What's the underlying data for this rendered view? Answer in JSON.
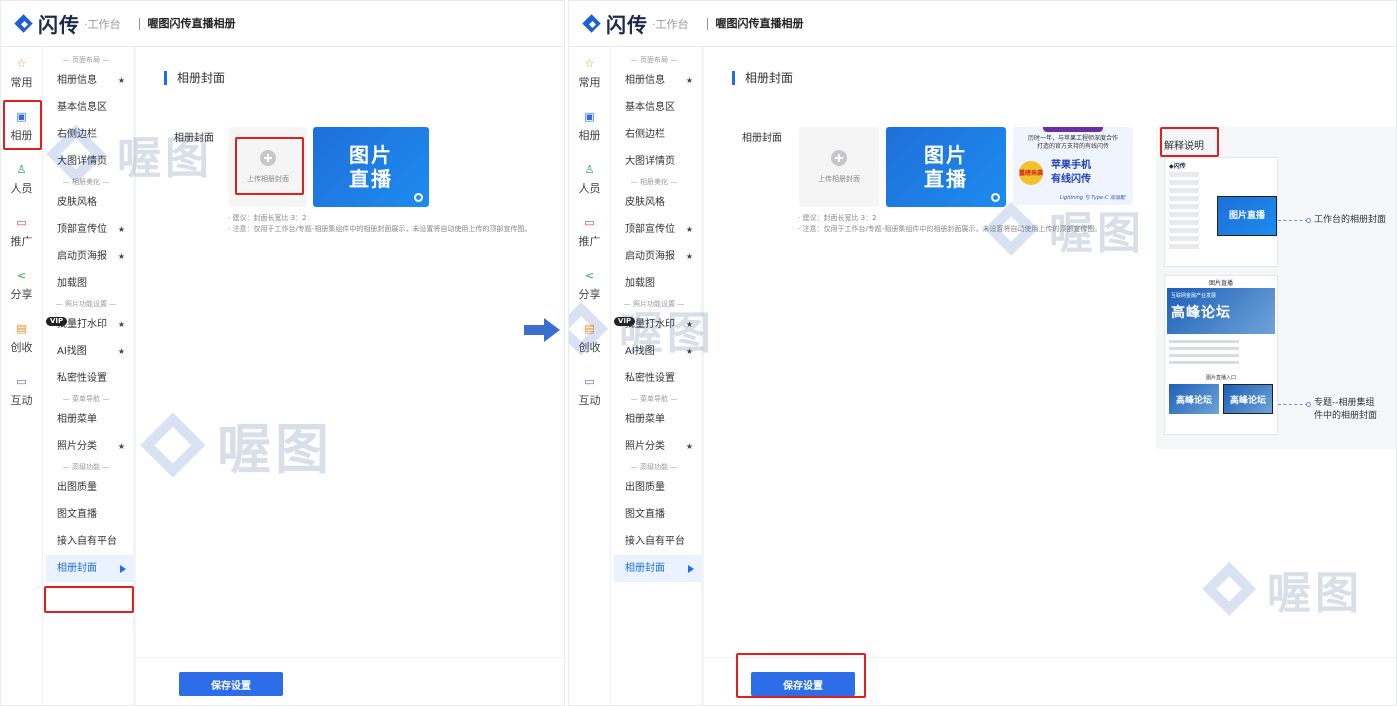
{
  "app": {
    "logo_text": "闪传",
    "logo_sub": "·工作台",
    "title": "喔图闪传直播相册"
  },
  "rail": [
    {
      "label": "常用",
      "icon": "star-icon"
    },
    {
      "label": "相册",
      "icon": "album-icon"
    },
    {
      "label": "人员",
      "icon": "people-icon"
    },
    {
      "label": "推广",
      "icon": "promote-icon"
    },
    {
      "label": "分享",
      "icon": "share-icon"
    },
    {
      "label": "创收",
      "icon": "revenue-icon"
    },
    {
      "label": "互动",
      "icon": "interact-icon"
    }
  ],
  "nav": {
    "group_layout": "— 页面布局 —",
    "group_beautify": "— 相册美化 —",
    "group_photo": "— 照片功能设置 —",
    "group_menu": "— 菜单导航 —",
    "group_advanced": "— 高级功能 —",
    "items": {
      "album_info": "相册信息",
      "basic_info": "基本信息区",
      "right_sidebar": "右侧边栏",
      "big_image": "大图详情页",
      "skin": "皮肤风格",
      "top_banner": "顶部宣传位",
      "splash": "启动页海报",
      "loading": "加载图",
      "watermark": "批量打水印",
      "ai_find": "AI找图",
      "privacy": "私密性设置",
      "album_menu": "相册菜单",
      "photo_category": "照片分类",
      "output_quality": "出图质量",
      "text_live": "图文直播",
      "platform": "接入自有平台",
      "album_cover": "相册封面"
    },
    "star": "★",
    "vip": "VIP"
  },
  "content": {
    "section_title": "相册封面",
    "field_label": "相册封面",
    "upload_label": "上传相册封面",
    "cover_text_line1": "图片",
    "cover_text_line2": "直播",
    "hint1": "· 建议：封面长宽比 3：2",
    "hint2": "· 注意：仅用于工作台/专题-相册集组件中的相册封面展示，未设置将自动使用上传的顶部宣传图。",
    "save_label": "保存设置"
  },
  "promo": {
    "head_line1": "历时一年，与苹果工程师深度合作",
    "head_line2": "打造的官方支持的有线闪传",
    "badge": "重磅来袭",
    "title_line1": "苹果手机",
    "title_line2": "有线闪传",
    "foot": "Lightning 与 Type-C 双适配"
  },
  "explain": {
    "title": "解释说明",
    "mini_logo": "◆闪传",
    "mini_cover": "图片直播",
    "mini2_head": "图片直播",
    "mini2_sub": "互联网金融产业发展",
    "mini2_big": "高峰论坛",
    "mini2_entry": "图片直播入口",
    "mini_card": "高峰论坛",
    "callout1": "工作台的相册封面",
    "callout2_line1": "专题--相册集组",
    "callout2_line2": "件中的相册封面"
  },
  "watermark": {
    "text": "喔图"
  },
  "colors": {
    "accent": "#2d6ee8",
    "highlight": "#e02020",
    "cover_bg": "#1f6fd8"
  }
}
